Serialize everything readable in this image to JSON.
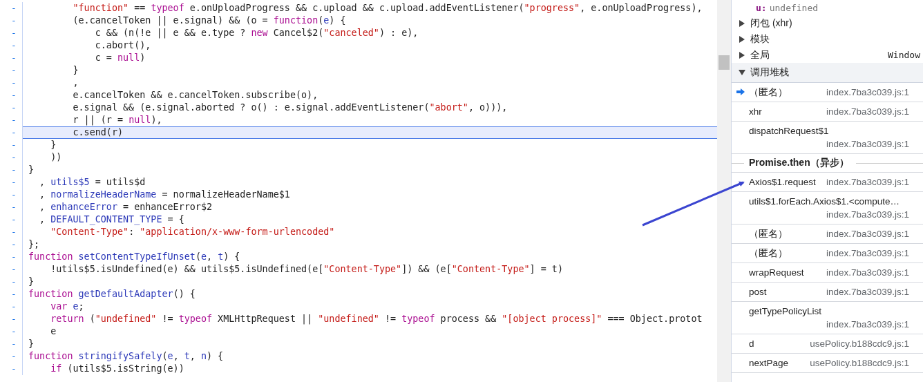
{
  "code": {
    "lines": [
      {
        "marker": "-",
        "highlighted": false,
        "tokens": [
          {
            "kind": "string",
            "text": "        \"function\""
          },
          {
            "kind": "plain",
            "text": " == "
          },
          {
            "kind": "keyword",
            "text": "typeof"
          },
          {
            "kind": "plain",
            "text": " e.onUploadProgress && c.upload && c.upload.addEventListener("
          },
          {
            "kind": "string",
            "text": "\"progress\""
          },
          {
            "kind": "plain",
            "text": ", e.onUploadProgress),"
          }
        ]
      },
      {
        "marker": "-",
        "highlighted": false,
        "tokens": [
          {
            "kind": "plain",
            "text": "        (e.cancelToken || e.signal) && (o = "
          },
          {
            "kind": "keyword",
            "text": "function"
          },
          {
            "kind": "plain",
            "text": "("
          },
          {
            "kind": "def",
            "text": "e"
          },
          {
            "kind": "plain",
            "text": ") {"
          }
        ]
      },
      {
        "marker": "-",
        "highlighted": false,
        "tokens": [
          {
            "kind": "plain",
            "text": "            c && (n(!e || e && e.type ? "
          },
          {
            "kind": "keyword",
            "text": "new"
          },
          {
            "kind": "plain",
            "text": " Cancel$2("
          },
          {
            "kind": "string",
            "text": "\"canceled\""
          },
          {
            "kind": "plain",
            "text": ") : e),"
          }
        ]
      },
      {
        "marker": "-",
        "highlighted": false,
        "tokens": [
          {
            "kind": "plain",
            "text": "            c.abort(),"
          }
        ]
      },
      {
        "marker": "-",
        "highlighted": false,
        "tokens": [
          {
            "kind": "plain",
            "text": "            c = "
          },
          {
            "kind": "keyword",
            "text": "null"
          },
          {
            "kind": "plain",
            "text": ")"
          }
        ]
      },
      {
        "marker": "-",
        "highlighted": false,
        "tokens": [
          {
            "kind": "plain",
            "text": "        }"
          }
        ]
      },
      {
        "marker": "-",
        "highlighted": false,
        "tokens": [
          {
            "kind": "plain",
            "text": "        ,"
          }
        ]
      },
      {
        "marker": "-",
        "highlighted": false,
        "tokens": [
          {
            "kind": "plain",
            "text": "        e.cancelToken && e.cancelToken.subscribe(o),"
          }
        ]
      },
      {
        "marker": "-",
        "highlighted": false,
        "tokens": [
          {
            "kind": "plain",
            "text": "        e.signal && (e.signal.aborted ? o() : e.signal.addEventListener("
          },
          {
            "kind": "string",
            "text": "\"abort\""
          },
          {
            "kind": "plain",
            "text": ", o))),"
          }
        ]
      },
      {
        "marker": "-",
        "highlighted": false,
        "tokens": [
          {
            "kind": "plain",
            "text": "        r || (r = "
          },
          {
            "kind": "keyword",
            "text": "null"
          },
          {
            "kind": "plain",
            "text": "),"
          }
        ]
      },
      {
        "marker": "-",
        "highlighted": true,
        "tokens": [
          {
            "kind": "plain",
            "text": "        c.send(r)"
          }
        ]
      },
      {
        "marker": "-",
        "highlighted": false,
        "tokens": [
          {
            "kind": "plain",
            "text": "    }"
          }
        ]
      },
      {
        "marker": "-",
        "highlighted": false,
        "tokens": [
          {
            "kind": "plain",
            "text": "    ))"
          }
        ]
      },
      {
        "marker": "-",
        "highlighted": false,
        "tokens": [
          {
            "kind": "plain",
            "text": "}"
          }
        ]
      },
      {
        "marker": "-",
        "highlighted": false,
        "tokens": [
          {
            "kind": "plain",
            "text": "  , "
          },
          {
            "kind": "def",
            "text": "utils$5"
          },
          {
            "kind": "plain",
            "text": " = utils$d"
          }
        ]
      },
      {
        "marker": "-",
        "highlighted": false,
        "tokens": [
          {
            "kind": "plain",
            "text": "  , "
          },
          {
            "kind": "def",
            "text": "normalizeHeaderName"
          },
          {
            "kind": "plain",
            "text": " = normalizeHeaderName$1"
          }
        ]
      },
      {
        "marker": "-",
        "highlighted": false,
        "tokens": [
          {
            "kind": "plain",
            "text": "  , "
          },
          {
            "kind": "def",
            "text": "enhanceError"
          },
          {
            "kind": "plain",
            "text": " = enhanceError$2"
          }
        ]
      },
      {
        "marker": "-",
        "highlighted": false,
        "tokens": [
          {
            "kind": "plain",
            "text": "  , "
          },
          {
            "kind": "def",
            "text": "DEFAULT_CONTENT_TYPE"
          },
          {
            "kind": "plain",
            "text": " = {"
          }
        ]
      },
      {
        "marker": "-",
        "highlighted": false,
        "tokens": [
          {
            "kind": "string",
            "text": "    \"Content-Type\""
          },
          {
            "kind": "plain",
            "text": ": "
          },
          {
            "kind": "string",
            "text": "\"application/x-www-form-urlencoded\""
          }
        ]
      },
      {
        "marker": "-",
        "highlighted": false,
        "tokens": [
          {
            "kind": "plain",
            "text": "};"
          }
        ]
      },
      {
        "marker": "-",
        "highlighted": false,
        "tokens": [
          {
            "kind": "keyword",
            "text": "function"
          },
          {
            "kind": "def",
            "text": " setContentTypeIfUnset"
          },
          {
            "kind": "plain",
            "text": "("
          },
          {
            "kind": "def",
            "text": "e"
          },
          {
            "kind": "plain",
            "text": ", "
          },
          {
            "kind": "def",
            "text": "t"
          },
          {
            "kind": "plain",
            "text": ") {"
          }
        ]
      },
      {
        "marker": "-",
        "highlighted": false,
        "tokens": [
          {
            "kind": "plain",
            "text": "    !utils$5.isUndefined(e) && utils$5.isUndefined(e["
          },
          {
            "kind": "string",
            "text": "\"Content-Type\""
          },
          {
            "kind": "plain",
            "text": "]) && (e["
          },
          {
            "kind": "string",
            "text": "\"Content-Type\""
          },
          {
            "kind": "plain",
            "text": "] = t)"
          }
        ]
      },
      {
        "marker": "-",
        "highlighted": false,
        "tokens": [
          {
            "kind": "plain",
            "text": "}"
          }
        ]
      },
      {
        "marker": "-",
        "highlighted": false,
        "tokens": [
          {
            "kind": "keyword",
            "text": "function"
          },
          {
            "kind": "def",
            "text": " getDefaultAdapter"
          },
          {
            "kind": "plain",
            "text": "() {"
          }
        ]
      },
      {
        "marker": "-",
        "highlighted": false,
        "tokens": [
          {
            "kind": "keyword",
            "text": "    var"
          },
          {
            "kind": "def",
            "text": " e"
          },
          {
            "kind": "plain",
            "text": ";"
          }
        ]
      },
      {
        "marker": "-",
        "highlighted": false,
        "tokens": [
          {
            "kind": "keyword",
            "text": "    return"
          },
          {
            "kind": "plain",
            "text": " ("
          },
          {
            "kind": "string",
            "text": "\"undefined\""
          },
          {
            "kind": "plain",
            "text": " != "
          },
          {
            "kind": "keyword",
            "text": "typeof"
          },
          {
            "kind": "plain",
            "text": " XMLHttpRequest || "
          },
          {
            "kind": "string",
            "text": "\"undefined\""
          },
          {
            "kind": "plain",
            "text": " != "
          },
          {
            "kind": "keyword",
            "text": "typeof"
          },
          {
            "kind": "plain",
            "text": " process && "
          },
          {
            "kind": "string",
            "text": "\"[object process]\""
          },
          {
            "kind": "plain",
            "text": " === Object.protot"
          }
        ]
      },
      {
        "marker": "-",
        "highlighted": false,
        "tokens": [
          {
            "kind": "plain",
            "text": "    e"
          }
        ]
      },
      {
        "marker": "-",
        "highlighted": false,
        "tokens": [
          {
            "kind": "plain",
            "text": "}"
          }
        ]
      },
      {
        "marker": "-",
        "highlighted": false,
        "tokens": [
          {
            "kind": "keyword",
            "text": "function"
          },
          {
            "kind": "def",
            "text": " stringifySafely"
          },
          {
            "kind": "plain",
            "text": "("
          },
          {
            "kind": "def",
            "text": "e"
          },
          {
            "kind": "plain",
            "text": ", "
          },
          {
            "kind": "def",
            "text": "t"
          },
          {
            "kind": "plain",
            "text": ", "
          },
          {
            "kind": "def",
            "text": "n"
          },
          {
            "kind": "plain",
            "text": ") {"
          }
        ]
      },
      {
        "marker": "-",
        "highlighted": false,
        "tokens": [
          {
            "kind": "keyword",
            "text": "    if"
          },
          {
            "kind": "plain",
            "text": " (utils$5.isString(e))"
          }
        ]
      }
    ]
  },
  "scope": {
    "variable": {
      "name": "u:",
      "value": "undefined"
    },
    "groups": [
      {
        "label": "闭包 (xhr)",
        "expanded": false
      },
      {
        "label": "模块",
        "expanded": false
      },
      {
        "label": "全局",
        "value": "Window",
        "expanded": false
      }
    ]
  },
  "call_stack": {
    "title": "调用堆栈",
    "expanded": true,
    "frames": [
      {
        "kind": "frame",
        "name": "（匿名）",
        "location": "index.7ba3c039.js:1",
        "current": true
      },
      {
        "kind": "frame",
        "name": "xhr",
        "location": "index.7ba3c039.js:1",
        "current": false
      },
      {
        "kind": "frame",
        "name": "dispatchRequest$1",
        "location": "index.7ba3c039.js:1",
        "current": false
      },
      {
        "kind": "async",
        "label": "Promise.then（异步）"
      },
      {
        "kind": "frame",
        "name": "Axios$1.request",
        "location": "index.7ba3c039.js:1",
        "current": false
      },
      {
        "kind": "frame",
        "name": "utils$1.forEach.Axios$1.<compute…",
        "location": "index.7ba3c039.js:1",
        "current": false
      },
      {
        "kind": "frame",
        "name": "（匿名）",
        "location": "index.7ba3c039.js:1",
        "current": false
      },
      {
        "kind": "frame",
        "name": "（匿名）",
        "location": "index.7ba3c039.js:1",
        "current": false
      },
      {
        "kind": "frame",
        "name": "wrapRequest",
        "location": "index.7ba3c039.js:1",
        "current": false
      },
      {
        "kind": "frame",
        "name": "post",
        "location": "index.7ba3c039.js:1",
        "current": false
      },
      {
        "kind": "frame",
        "name": "getTypePolicyList",
        "location": "index.7ba3c039.js:1",
        "current": false
      },
      {
        "kind": "frame",
        "name": "d",
        "location": "usePolicy.b188cdc9.js:1",
        "current": false
      },
      {
        "kind": "frame",
        "name": "nextPage",
        "location": "usePolicy.b188cdc9.js:1",
        "current": false
      }
    ]
  }
}
